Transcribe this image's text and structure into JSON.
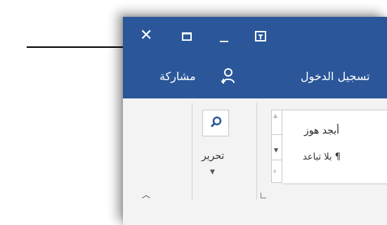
{
  "titlebar": {
    "close_glyph": "✕",
    "controls": [
      "close-icon",
      "maximize-icon",
      "minimize-icon",
      "ribbon-display-options-icon"
    ]
  },
  "menubar": {
    "sign_in": "تسجيل الدخول",
    "share": "مشاركة"
  },
  "ribbon": {
    "editing_group": {
      "label": "تحرير"
    },
    "styles": [
      "أبجد هوز",
      "¶ بلا تباعد"
    ]
  },
  "colors": {
    "accent": "#2b579a",
    "ribbon_bg": "#f3f3f3"
  }
}
